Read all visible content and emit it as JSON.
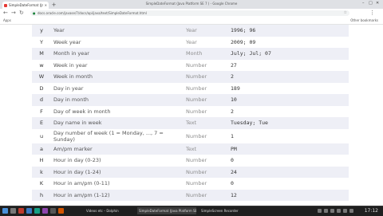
{
  "browser": {
    "tab_title": "SimpleDateFormat (Java Platform SE 7 )",
    "window_title": "SimpleDateFormat (Java Platform SE 7 ) - Google Chrome",
    "url": "docs.oracle.com/javase/7/docs/api/java/text/SimpleDateFormat.html",
    "bookmarks": {
      "apps": "Apps",
      "other": "Other bookmarks"
    }
  },
  "table": {
    "rows": [
      {
        "letter": "y",
        "component": "Year",
        "presentation": "Year",
        "examples": "1996; 96"
      },
      {
        "letter": "Y",
        "component": "Week year",
        "presentation": "Year",
        "examples": "2009; 09"
      },
      {
        "letter": "M",
        "component": "Month in year",
        "presentation": "Month",
        "examples": "July; Jul; 07"
      },
      {
        "letter": "w",
        "component": "Week in year",
        "presentation": "Number",
        "examples": "27"
      },
      {
        "letter": "W",
        "component": "Week in month",
        "presentation": "Number",
        "examples": "2"
      },
      {
        "letter": "D",
        "component": "Day in year",
        "presentation": "Number",
        "examples": "189"
      },
      {
        "letter": "d",
        "component": "Day in month",
        "presentation": "Number",
        "examples": "10"
      },
      {
        "letter": "F",
        "component": "Day of week in month",
        "presentation": "Number",
        "examples": "2"
      },
      {
        "letter": "E",
        "component": "Day name in week",
        "presentation": "Text",
        "examples": "Tuesday; Tue"
      },
      {
        "letter": "u",
        "component": "Day number of week (1 = Monday, ..., 7 = Sunday)",
        "presentation": "Number",
        "examples": "1"
      },
      {
        "letter": "a",
        "component": "Am/pm marker",
        "presentation": "Text",
        "examples": "PM"
      },
      {
        "letter": "H",
        "component": "Hour in day (0-23)",
        "presentation": "Number",
        "examples": "0"
      },
      {
        "letter": "k",
        "component": "Hour in day (1-24)",
        "presentation": "Number",
        "examples": "24"
      },
      {
        "letter": "K",
        "component": "Hour in am/pm (0-11)",
        "presentation": "Number",
        "examples": "0"
      },
      {
        "letter": "h",
        "component": "Hour in am/pm (1-12)",
        "presentation": "Number",
        "examples": "12"
      }
    ]
  },
  "taskbar": {
    "items": [
      "Videos etc – Dolphin",
      "SimpleDateFormat (Java Platform SE...",
      "SimpleScreen Recorder"
    ],
    "clock": "17:12"
  },
  "colors": {
    "row_alt": "#eeeff6",
    "tab_favicon": "#e53935"
  }
}
